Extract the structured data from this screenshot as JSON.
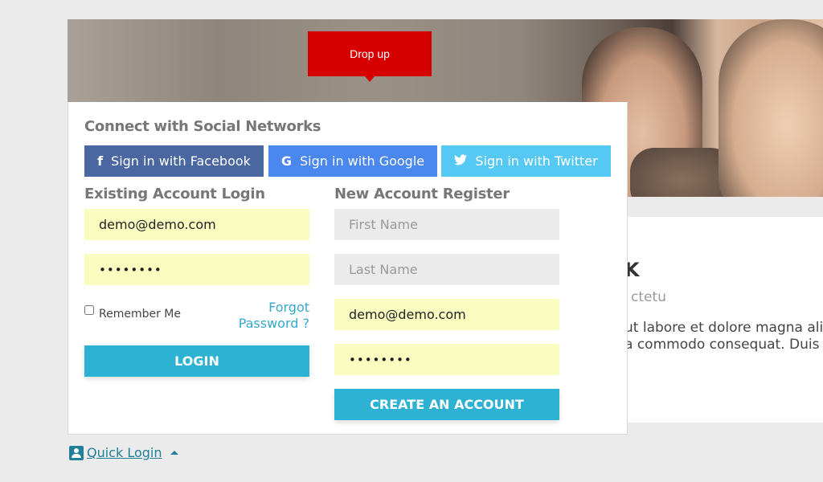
{
  "hero": {
    "alt": "two women portrait banner"
  },
  "drop_up": {
    "label": "Drop up",
    "color": "#d60000"
  },
  "content_card": {
    "title": "K",
    "subtitle": "ctetu",
    "body_line1": "ut labore et dolore magna ali",
    "body_line2": "a commodo consequat. Duis"
  },
  "panel": {
    "social": {
      "title": "Connect with Social Networks",
      "buttons": [
        {
          "label": "Sign in with Facebook",
          "icon": "facebook-icon",
          "glyph": "f",
          "color": "#4a67a1"
        },
        {
          "label": "Sign in with Google",
          "icon": "google-icon",
          "glyph": "G",
          "color": "#4a87ee"
        },
        {
          "label": "Sign in with Twitter",
          "icon": "twitter-icon",
          "glyph": "🐦",
          "color": "#55c9f4"
        }
      ]
    },
    "login": {
      "title": "Existing Account Login",
      "email_value": "demo@demo.com",
      "password_value": "••••••••",
      "remember_label": "Remember Me",
      "remember_checked": false,
      "forgot_label": "Forgot Password ?",
      "submit_label": "LOGIN"
    },
    "register": {
      "title": "New Account Register",
      "first_name_placeholder": "First Name",
      "last_name_placeholder": "Last Name",
      "email_value": "demo@demo.com",
      "password_value": "••••••••",
      "submit_label": "CREATE AN ACCOUNT"
    }
  },
  "quick_login": {
    "label": " Quick Login "
  },
  "colors": {
    "accent": "#2db2d3",
    "link": "#35a8cc",
    "autofill": "#fafdc0"
  }
}
